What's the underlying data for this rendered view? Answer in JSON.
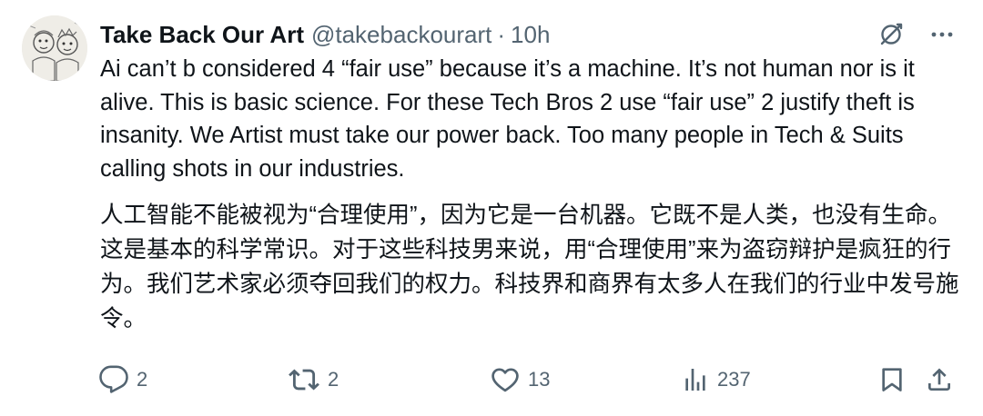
{
  "author": {
    "display_name": "Take Back Our Art",
    "handle": "@takebackourart",
    "separator": "·",
    "time": "10h"
  },
  "icons": {
    "avatar": "avatar-sketch",
    "grok": "grok-icon",
    "more": "more-icon",
    "reply": "reply-icon",
    "retweet": "retweet-icon",
    "like": "like-icon",
    "views": "views-icon",
    "bookmark": "bookmark-icon",
    "share": "share-icon"
  },
  "tweet": {
    "text_en": "Ai can’t b considered 4 “fair use” because it’s a machine. It’s not human nor is it alive. This is basic science. For these Tech Bros 2 use “fair use” 2 justify theft is insanity. We Artist must take our power back. Too many people in Tech & Suits calling shots in our industries.",
    "text_zh": "人工智能不能被视为“合理使用”，因为它是一台机器。它既不是人类，也没有生命。这是基本的科学常识。对于这些科技男来说，用“合理使用”来为盗窃辩护是疯狂的行为。我们艺术家必须夺回我们的权力。科技界和商界有太多人在我们的行业中发号施令。"
  },
  "stats": {
    "replies": "2",
    "retweets": "2",
    "likes": "13",
    "views": "237"
  },
  "colors": {
    "text_primary": "#0f1419",
    "text_secondary": "#536471",
    "background": "#ffffff"
  }
}
